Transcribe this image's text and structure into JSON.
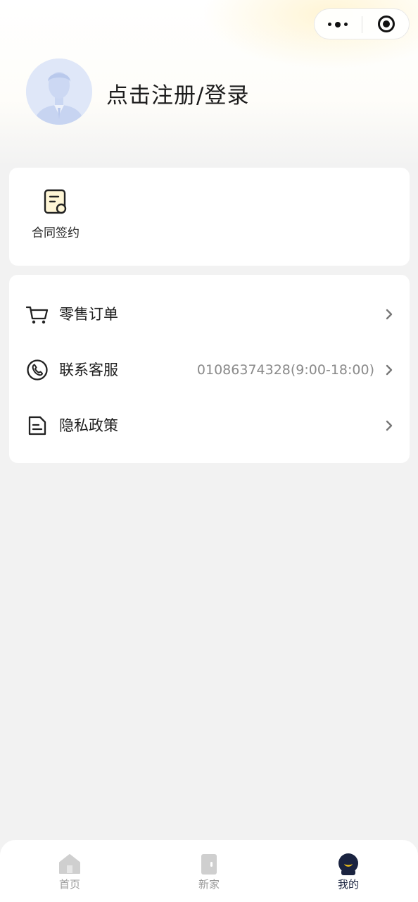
{
  "header": {
    "login_text": "点击注册/登录"
  },
  "quick_actions": [
    {
      "label": "合同签约",
      "icon": "contract-icon"
    }
  ],
  "menu": [
    {
      "label": "零售订单",
      "value": "",
      "icon": "cart-icon"
    },
    {
      "label": "联系客服",
      "value": "01086374328(9:00-18:00)",
      "icon": "phone-icon"
    },
    {
      "label": "隐私政策",
      "value": "",
      "icon": "document-icon"
    }
  ],
  "tabbar": {
    "tabs": [
      {
        "label": "首页",
        "icon": "home-icon",
        "active": false
      },
      {
        "label": "新家",
        "icon": "door-icon",
        "active": false
      },
      {
        "label": "我的",
        "icon": "profile-icon",
        "active": true
      }
    ]
  },
  "colors": {
    "background": "#f2f2f2",
    "card": "#ffffff",
    "accent_yellow": "#f5c518",
    "active_tab": "#1a2340",
    "inactive_tab": "#9a9a9a"
  }
}
